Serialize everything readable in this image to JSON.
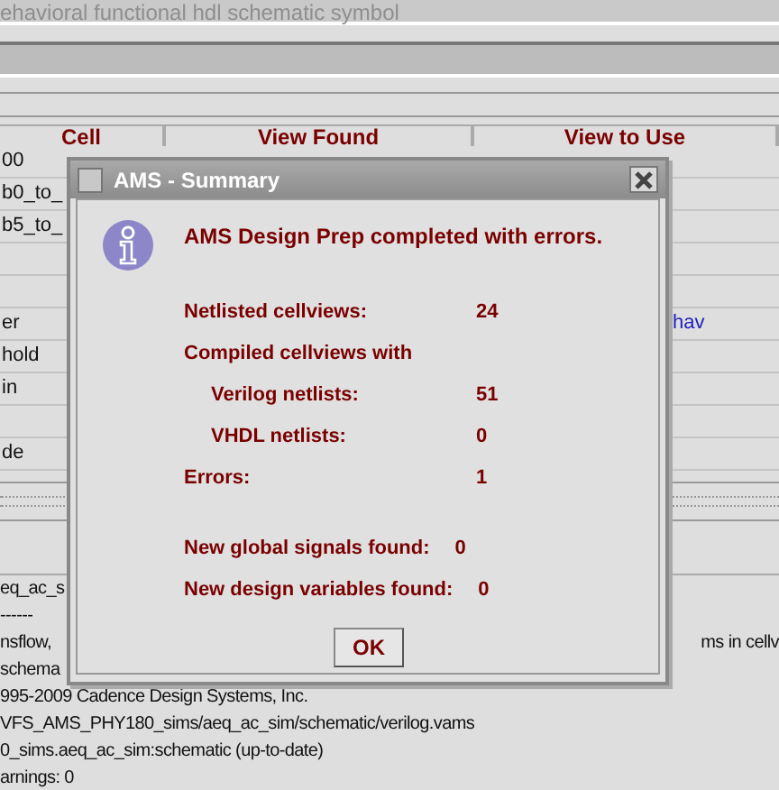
{
  "background_window": {
    "title": "ehavioral functional hdl schematic symbol"
  },
  "table": {
    "columns": [
      "Cell",
      "View Found",
      "View to Use"
    ],
    "rows": [
      {
        "cell": "00"
      },
      {
        "cell": "b0_to_"
      },
      {
        "cell": "b5_to_"
      },
      {},
      {},
      {
        "cell": "er",
        "view_to_use": "hav"
      },
      {
        "cell": "hold"
      },
      {
        "cell": "in"
      },
      {},
      {
        "cell": "de"
      }
    ]
  },
  "log": {
    "lines": [
      {
        "left": "eq_ac_s"
      },
      {
        "left": "------"
      },
      {
        "left": "nsflow,",
        "right": "ms in cellv"
      },
      {
        "left": "schema"
      },
      {
        "left": "995-2009 Cadence Design Systems, Inc."
      },
      {
        "left": "VFS_AMS_PHY180_sims/aeq_ac_sim/schematic/verilog.vams"
      },
      {
        "left": "0_sims.aeq_ac_sim:schematic (up-to-date)"
      },
      {
        "left": "arnings: 0"
      }
    ]
  },
  "dialog": {
    "title": "AMS - Summary",
    "message": "AMS Design Prep completed with errors.",
    "sections": [
      [
        {
          "label": "Netlisted cellviews:",
          "value": "24"
        },
        {
          "label": "Compiled cellviews with",
          "children": [
            {
              "label": "Verilog netlists:",
              "value": "51"
            },
            {
              "label": "VHDL netlists:",
              "value": "0"
            }
          ]
        },
        {
          "label": "Errors:",
          "value": "1"
        }
      ],
      [
        {
          "label": "New global signals found:",
          "value": "0"
        },
        {
          "label": "New design variables found:",
          "value": "0"
        }
      ]
    ],
    "button": "OK"
  }
}
